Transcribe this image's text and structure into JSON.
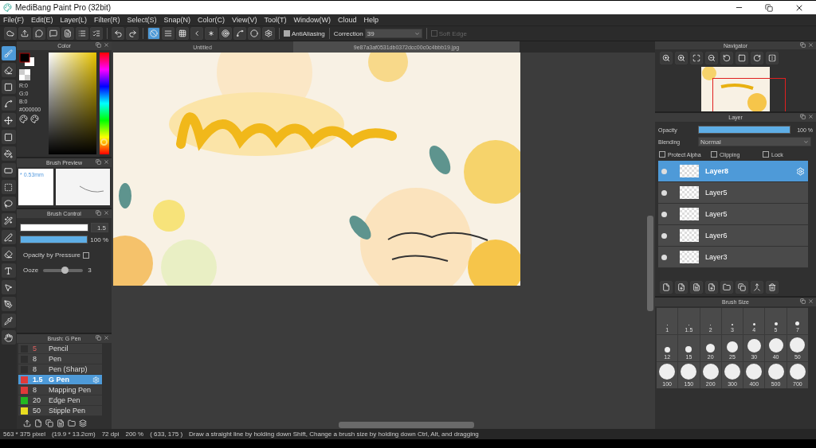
{
  "window": {
    "title": "MediBang Paint Pro (32bit)"
  },
  "menu": [
    "File(F)",
    "Edit(E)",
    "Layer(L)",
    "Filter(R)",
    "Select(S)",
    "Snap(N)",
    "Color(C)",
    "View(V)",
    "Tool(T)",
    "Window(W)",
    "Cloud",
    "Help"
  ],
  "toolbar": {
    "snap_tools": [
      {
        "selected": true
      },
      {
        "selected": false
      },
      {
        "selected": false
      },
      {
        "selected": false
      },
      {
        "selected": false
      },
      {
        "selected": false
      },
      {
        "selected": false
      },
      {
        "selected": false
      },
      {
        "selected": false
      }
    ],
    "anti_aliasing": {
      "label": "AntiAliasing",
      "checked": true
    },
    "correction": {
      "label": "Correction",
      "value": "39"
    },
    "soft_edge": {
      "label": "Soft Edge",
      "checked": false,
      "disabled": true
    }
  },
  "tools": [
    {
      "selected": true
    },
    {
      "selected": false
    },
    {
      "selected": false
    },
    {
      "selected": false
    },
    {
      "selected": false
    },
    {
      "selected": false
    },
    {
      "selected": false
    },
    {
      "selected": false
    },
    {
      "selected": false
    },
    {
      "selected": false
    },
    {
      "selected": false
    },
    {
      "selected": false
    },
    {
      "selected": false
    },
    {
      "selected": false
    },
    {
      "selected": false
    },
    {
      "selected": false
    },
    {
      "selected": false
    },
    {
      "selected": false
    }
  ],
  "color_panel": {
    "title": "Color",
    "hue": {
      "level": 0.12
    },
    "rgb": [
      "R:0",
      "G:0",
      "B:0"
    ],
    "hex": "#000000"
  },
  "brush_preview": {
    "title": "Brush Preview",
    "size": "* 0.53mm"
  },
  "brush_control": {
    "title": "Brush Control",
    "size": {
      "level": 1,
      "value": "1.5"
    },
    "opacity": {
      "level": 1,
      "value": "100 %"
    },
    "opacity_by_pressure": {
      "label": "Opacity by Pressure",
      "checked": false
    },
    "ooze": {
      "label": "Ooze",
      "level": 0.55,
      "value": "3"
    }
  },
  "brush_list": {
    "title": "Brush: G Pen",
    "items": [
      {
        "size": "5",
        "name": "Pencil",
        "color": "#2e2e2e",
        "selected": false
      },
      {
        "size": "8",
        "name": "Pen",
        "color": "#2e2e2e",
        "selected": false
      },
      {
        "size": "8",
        "name": "Pen (Sharp)",
        "color": "#2e2e2e",
        "selected": false
      },
      {
        "size": "1.5",
        "name": "G Pen",
        "color": "#e03a3a",
        "selected": true
      },
      {
        "size": "8",
        "name": "Mapping Pen",
        "color": "#e03a3a",
        "selected": false
      },
      {
        "size": "20",
        "name": "Edge Pen",
        "color": "#22b822",
        "selected": false
      },
      {
        "size": "50",
        "name": "Stipple Pen",
        "color": "#e8dc20",
        "selected": false
      }
    ]
  },
  "document_tabs": [
    {
      "label": "Untitled",
      "selected": false
    },
    {
      "label": "9e87a3af0531db0372dcc00c0c4bbb19.jpg",
      "selected": true
    }
  ],
  "navigator": {
    "title": "Navigator"
  },
  "layer_panel": {
    "title": "Layer",
    "opacity": {
      "label": "Opacity",
      "level": 1,
      "value": "100 %"
    },
    "blending": {
      "label": "Blending",
      "value": "Normal"
    },
    "options": [
      {
        "label": "Protect Alpha",
        "checked": false
      },
      {
        "label": "Clipping",
        "checked": false
      },
      {
        "label": "Lock",
        "checked": false
      }
    ],
    "layers": [
      {
        "name": "Layer8",
        "selected": true
      },
      {
        "name": "Layer5",
        "selected": false
      },
      {
        "name": "Layer5",
        "selected": false
      },
      {
        "name": "Layer6",
        "selected": false
      },
      {
        "name": "Layer3",
        "selected": false
      }
    ]
  },
  "brush_size": {
    "title": "Brush Size",
    "sizes": [
      "1",
      "1.5",
      "2",
      "3",
      "4",
      "5",
      "7",
      "12",
      "15",
      "20",
      "25",
      "30",
      "40",
      "50",
      "100",
      "150",
      "200",
      "300",
      "400",
      "500",
      "700"
    ]
  },
  "status_bar": [
    "563 * 375 pixel",
    "(19.9 * 13.2cm)",
    "72 dpi",
    "200 %",
    "( 633, 175 )",
    "Draw a straight line by holding down Shift, Change a brush size by holding down Ctrl, Alt, and dragging"
  ]
}
